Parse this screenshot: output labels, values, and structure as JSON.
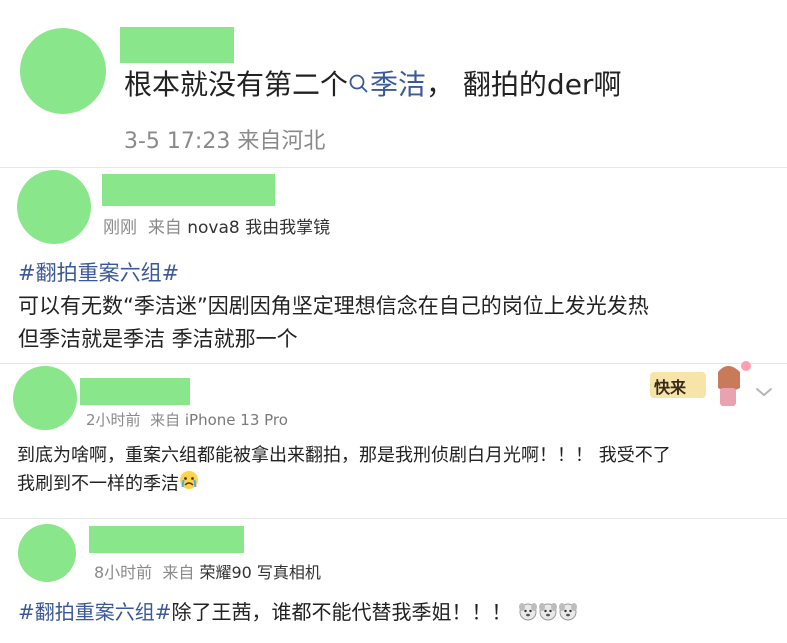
{
  "colors": {
    "placeholder_green": "#8ae68a",
    "topic_blue": "#3b5998",
    "meta_gray": "#8a8a8a"
  },
  "post1": {
    "content_before": "根本就没有第二个",
    "mention_icon": "search-icon",
    "mention": "季洁",
    "content_after": "， 翻拍的der啊",
    "meta": "3-5 17:23  来自河北"
  },
  "post2": {
    "time": "刚刚",
    "source_prefix": "来自",
    "source": "nova8 我由我掌镜",
    "hashtag": "#翻拍重案六组#",
    "line1": "可以有无数“季洁迷”因剧因角坚定理想信念在自己的岗位上发光发热",
    "line2": "但季洁就是季洁 季洁就那一个"
  },
  "post3": {
    "time": "2小时前",
    "source_prefix": "来自",
    "source": "iPhone 13 Pro",
    "sticker_text": "快来",
    "line1": "到底为啥啊，重案六组都能被拿出来翻拍，那是我刑侦剧白月光啊！！！ 我受不了",
    "line2": "我刷到不一样的季洁",
    "emoji": "crying-face-icon"
  },
  "post4": {
    "time": "8小时前",
    "source_prefix": "来自",
    "source": "荣耀90 写真相机",
    "hashtag": "#翻拍重案六组#",
    "text": "除了王茜，谁都不能代替我季姐！！！",
    "emoji": "sad-dog-icon"
  }
}
